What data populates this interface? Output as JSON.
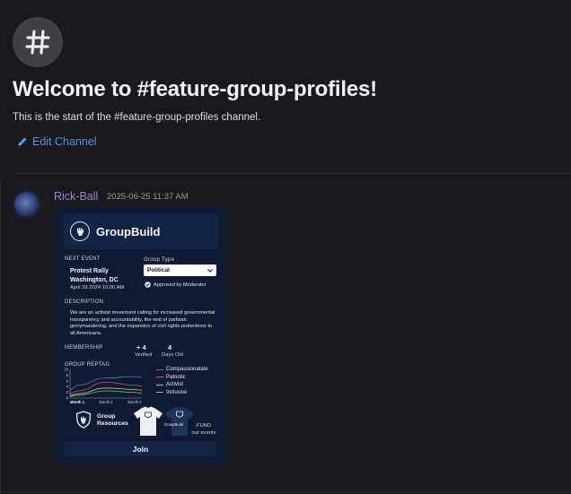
{
  "channel": {
    "hash_symbol": "#",
    "welcome_title": "Welcome to #feature-group-profiles!",
    "welcome_subtitle": "This is the start of the #feature-group-profiles channel.",
    "edit_label": "Edit Channel"
  },
  "message": {
    "author": "Rick-Ball",
    "timestamp": "2025-06-25 11:37 AM",
    "author_color": "#a77fd6"
  },
  "card": {
    "brand": "GroupBuild",
    "next_event_label": "NEXT EVENT",
    "event_name_line1": "Protest Rally",
    "event_name_line2": "Washington, DC",
    "event_date": "April 29 2024 10:00 AM",
    "group_type_label": "Group Type",
    "group_type_value": "Political",
    "approved_label": "Approved by Moderator",
    "description_label": "DESCRIPTION",
    "description": "We are an activist movement calling for increased governmental transparency and accountability, the end of partisan gerrymandering, and the expansion of civil rights protections to all Americans.",
    "membership_label": "MEMBERSHIP",
    "verified_value": "+ 4",
    "verified_label": "Verified",
    "days_value": "4",
    "days_label": "Days Old",
    "reptag_label": "GROUP REPTAG",
    "resources_line1": "Group",
    "resources_line2": "Resources",
    "shirt_text": "GroupBuild",
    "fund_line1": "FUND",
    "fund_line2": "our events",
    "join_label": "Join"
  },
  "chart_data": {
    "type": "line",
    "title": "GROUP REPTAG",
    "categories": [
      "Month 1",
      "Month 2",
      "Month 3"
    ],
    "yticks": [
      "10",
      "8",
      "6",
      "4",
      "2",
      "0"
    ],
    "ylim": [
      0,
      10
    ],
    "series": [
      {
        "name": "Compassionatate",
        "color": "#4a78c8",
        "values": [
          4.5,
          7.0,
          7.5
        ]
      },
      {
        "name": "Patriotic",
        "color": "#c9566a",
        "values": [
          2.5,
          5.5,
          4.5
        ]
      },
      {
        "name": "Activist",
        "color": "#d8cf4e",
        "values": [
          1.5,
          3.5,
          3.0
        ]
      },
      {
        "name": "Inclusive",
        "color": "#5cc98a",
        "values": [
          1.0,
          2.5,
          2.0
        ]
      }
    ],
    "legend": "right",
    "grid": false
  }
}
